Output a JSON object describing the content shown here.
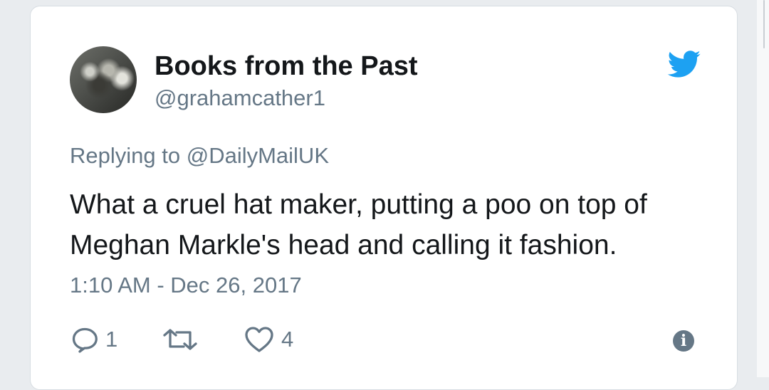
{
  "tweet": {
    "author_name": "Books from the Past",
    "handle": "@grahamcather1",
    "replying_prefix": "Replying to",
    "replying_to": "@DailyMailUK",
    "text_line_1": "What a cruel hat maker, putting a poo on top of",
    "text_line_2": "Meghan Markle's head and calling it fashion.",
    "timestamp": "1:10 AM - Dec 26, 2017"
  },
  "actions": {
    "reply_count": "1",
    "retweet_count": "",
    "like_count": "4"
  },
  "icons": {
    "brand": "twitter-bird-icon",
    "reply": "speech-bubble-icon",
    "retweet": "retweet-arrows-icon",
    "like": "heart-icon",
    "info": "info-icon"
  },
  "colors": {
    "brand_blue": "#1da1f2",
    "secondary_text": "#657786",
    "primary_text": "#14171a"
  }
}
